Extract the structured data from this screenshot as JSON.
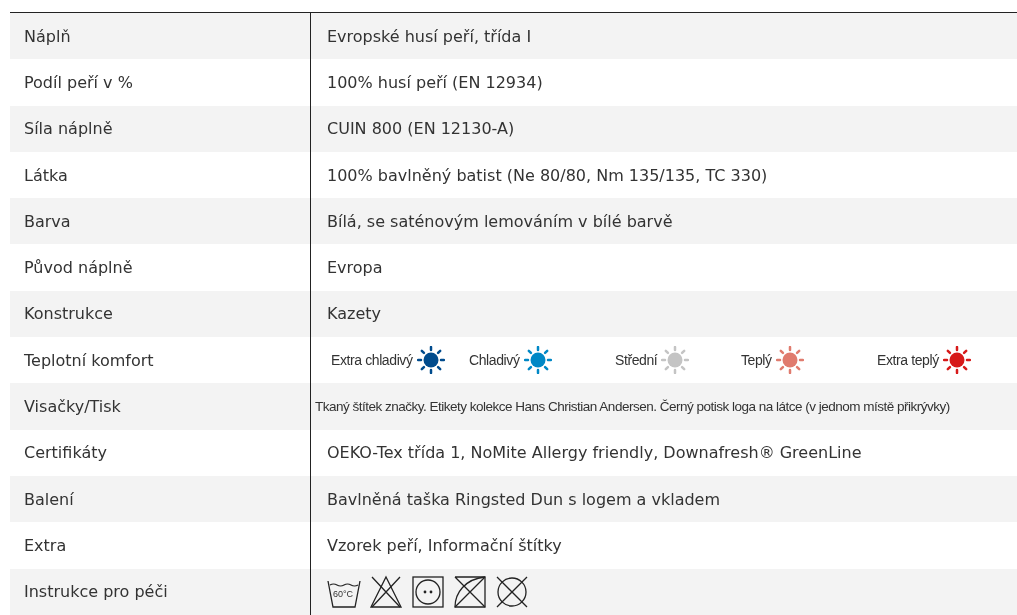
{
  "rows": [
    {
      "kind": "text",
      "label": "Náplň",
      "value": "Evropské husí peří, třída I"
    },
    {
      "kind": "text",
      "label": "Podíl peří v %",
      "value": "100% husí peří (EN 12934)"
    },
    {
      "kind": "text",
      "label": "Síla náplně",
      "value": "CUIN 800 (EN 12130-A)"
    },
    {
      "kind": "text",
      "label": "Látka",
      "value": "100% bavlněný batist (Ne 80/80, Nm 135/135, TC 330)"
    },
    {
      "kind": "text",
      "label": "Barva",
      "value": "Bílá, se saténovým lemováním v bílé barvě"
    },
    {
      "kind": "text",
      "label": "Původ náplně",
      "value": "Evropa"
    },
    {
      "kind": "text",
      "label": "Konstrukce",
      "value": "Kazety"
    },
    {
      "kind": "comfort",
      "label": "Teplotní komfort",
      "levels": [
        {
          "label": "Extra chladivý",
          "color": "#004b8d"
        },
        {
          "label": "Chladivý",
          "color": "#0088c6"
        },
        {
          "label": "Střední",
          "color": "#c4c4c4"
        },
        {
          "label": "Teplý",
          "color": "#e07b6e"
        },
        {
          "label": "Extra teplý",
          "color": "#d71a1a"
        }
      ]
    },
    {
      "kind": "small",
      "label": "Visačky/Tisk",
      "value": "Tkaný štítek značky. Etikety kolekce Hans Christian Andersen. Černý potisk loga na látce (v jednom místě přikrývky)"
    },
    {
      "kind": "text",
      "label": "Certifikáty",
      "value": "OEKO-Tex třída 1, NoMite Allergy friendly, Downafresh® GreenLine"
    },
    {
      "kind": "text",
      "label": "Balení",
      "value": "Bavlněná taška Ringsted Dun s logem a vkladem"
    },
    {
      "kind": "text",
      "label": "Extra",
      "value": "Vzorek peří, Informační  štítky"
    },
    {
      "kind": "care",
      "label": "Instrukce pro péči",
      "wash_temperature": "60°C"
    }
  ]
}
